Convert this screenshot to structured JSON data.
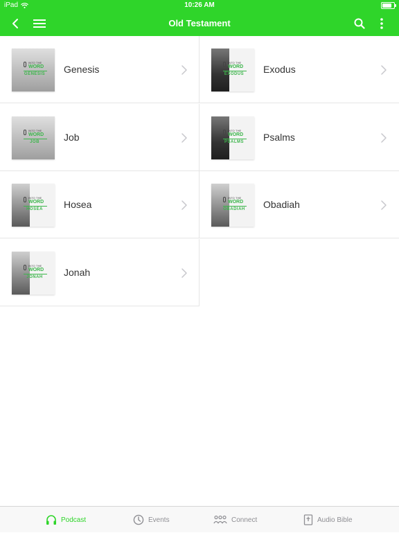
{
  "status": {
    "device": "iPad",
    "time": "10:26 AM",
    "battery_level": 0.8
  },
  "nav": {
    "title": "Old Testament"
  },
  "podcast_logo": {
    "top": "INTO THE",
    "word": "WORD"
  },
  "books": [
    {
      "title": "Genesis",
      "logo_title": "GENESIS",
      "art": "wide"
    },
    {
      "title": "Exodus",
      "logo_title": "EXODUS",
      "art": "dark"
    },
    {
      "title": "Job",
      "logo_title": "JOB",
      "art": "wide"
    },
    {
      "title": "Psalms",
      "logo_title": "PSALMS",
      "art": "dark"
    },
    {
      "title": "Hosea",
      "logo_title": "HOSEA",
      "art": "normal"
    },
    {
      "title": "Obadiah",
      "logo_title": "OBADIAH",
      "art": "normal"
    },
    {
      "title": "Jonah",
      "logo_title": "JONAH",
      "art": "normal"
    }
  ],
  "tabs": [
    {
      "label": "Podcast",
      "icon": "headphones-icon",
      "active": true
    },
    {
      "label": "Events",
      "icon": "clock-icon",
      "active": false
    },
    {
      "label": "Connect",
      "icon": "people-icon",
      "active": false
    },
    {
      "label": "Audio Bible",
      "icon": "bible-icon",
      "active": false
    }
  ],
  "colors": {
    "accent": "#2fd52a",
    "logo_green": "#3bb54a",
    "tab_inactive": "#8e8e93"
  }
}
